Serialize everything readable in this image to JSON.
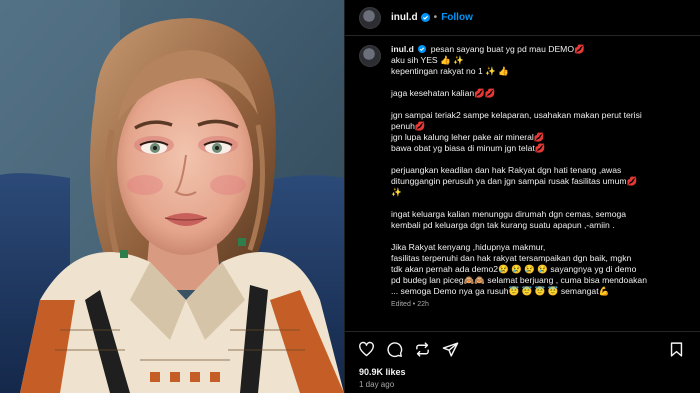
{
  "colors": {
    "accent": "#0095f6",
    "background": "#000000",
    "text": "#f5f5f5",
    "muted": "#a8a8a8",
    "divider": "#262626"
  },
  "header": {
    "username": "inul.d",
    "separator": "•",
    "follow_label": "Follow",
    "icons": [
      "avatar",
      "verified-badge-icon"
    ]
  },
  "caption": {
    "username": "inul.d",
    "lines": [
      "pesan sayang buat yg pd mau DEMO💋",
      "aku sih YES 👍 ✨",
      "kepentingan rakyat no 1 ✨ 👍",
      "",
      "jaga kesehatan kalian💋💋",
      "",
      "jgn sampai teriak2 sampe kelaparan, usahakan makan perut terisi",
      "penuh💋",
      "jgn lupa kalung leher pake air mineral💋",
      "bawa obat yg biasa di minum jgn telat💋",
      "",
      "perjuangkan keadilan dan hak Rakyat dgn hati tenang ,awas",
      "ditunggangin perusuh ya dan jgn sampai rusak fasilitas umum💋",
      "✨",
      "",
      "ingat keluarga kalian menunggu dirumah dgn cemas, semoga",
      "kembali pd keluarga dgn tak kurang suatu apapun ,-amiin .",
      "",
      "Jika Rakyat kenyang ,hidupnya makmur,",
      "fasilitas terpenuhi dan hak rakyat tersampaikan dgn baik, mgkn",
      "tdk akan pernah ada demo2😢 😢 😢 😢 sayangnya yg di demo",
      "pd budeg lan piceg🙈🙈 selamat berjuang , cuma bisa mendoakan",
      "... semoga Demo nya ga rusuh😇 😇 😇 😇 semangat💪"
    ],
    "edited": "Edited • 22h"
  },
  "actions": {
    "icons": [
      "heart-icon",
      "comment-icon",
      "repost-icon",
      "share-icon",
      "bookmark-icon"
    ]
  },
  "likes": "90.9K likes",
  "timestamp": "1 day ago"
}
